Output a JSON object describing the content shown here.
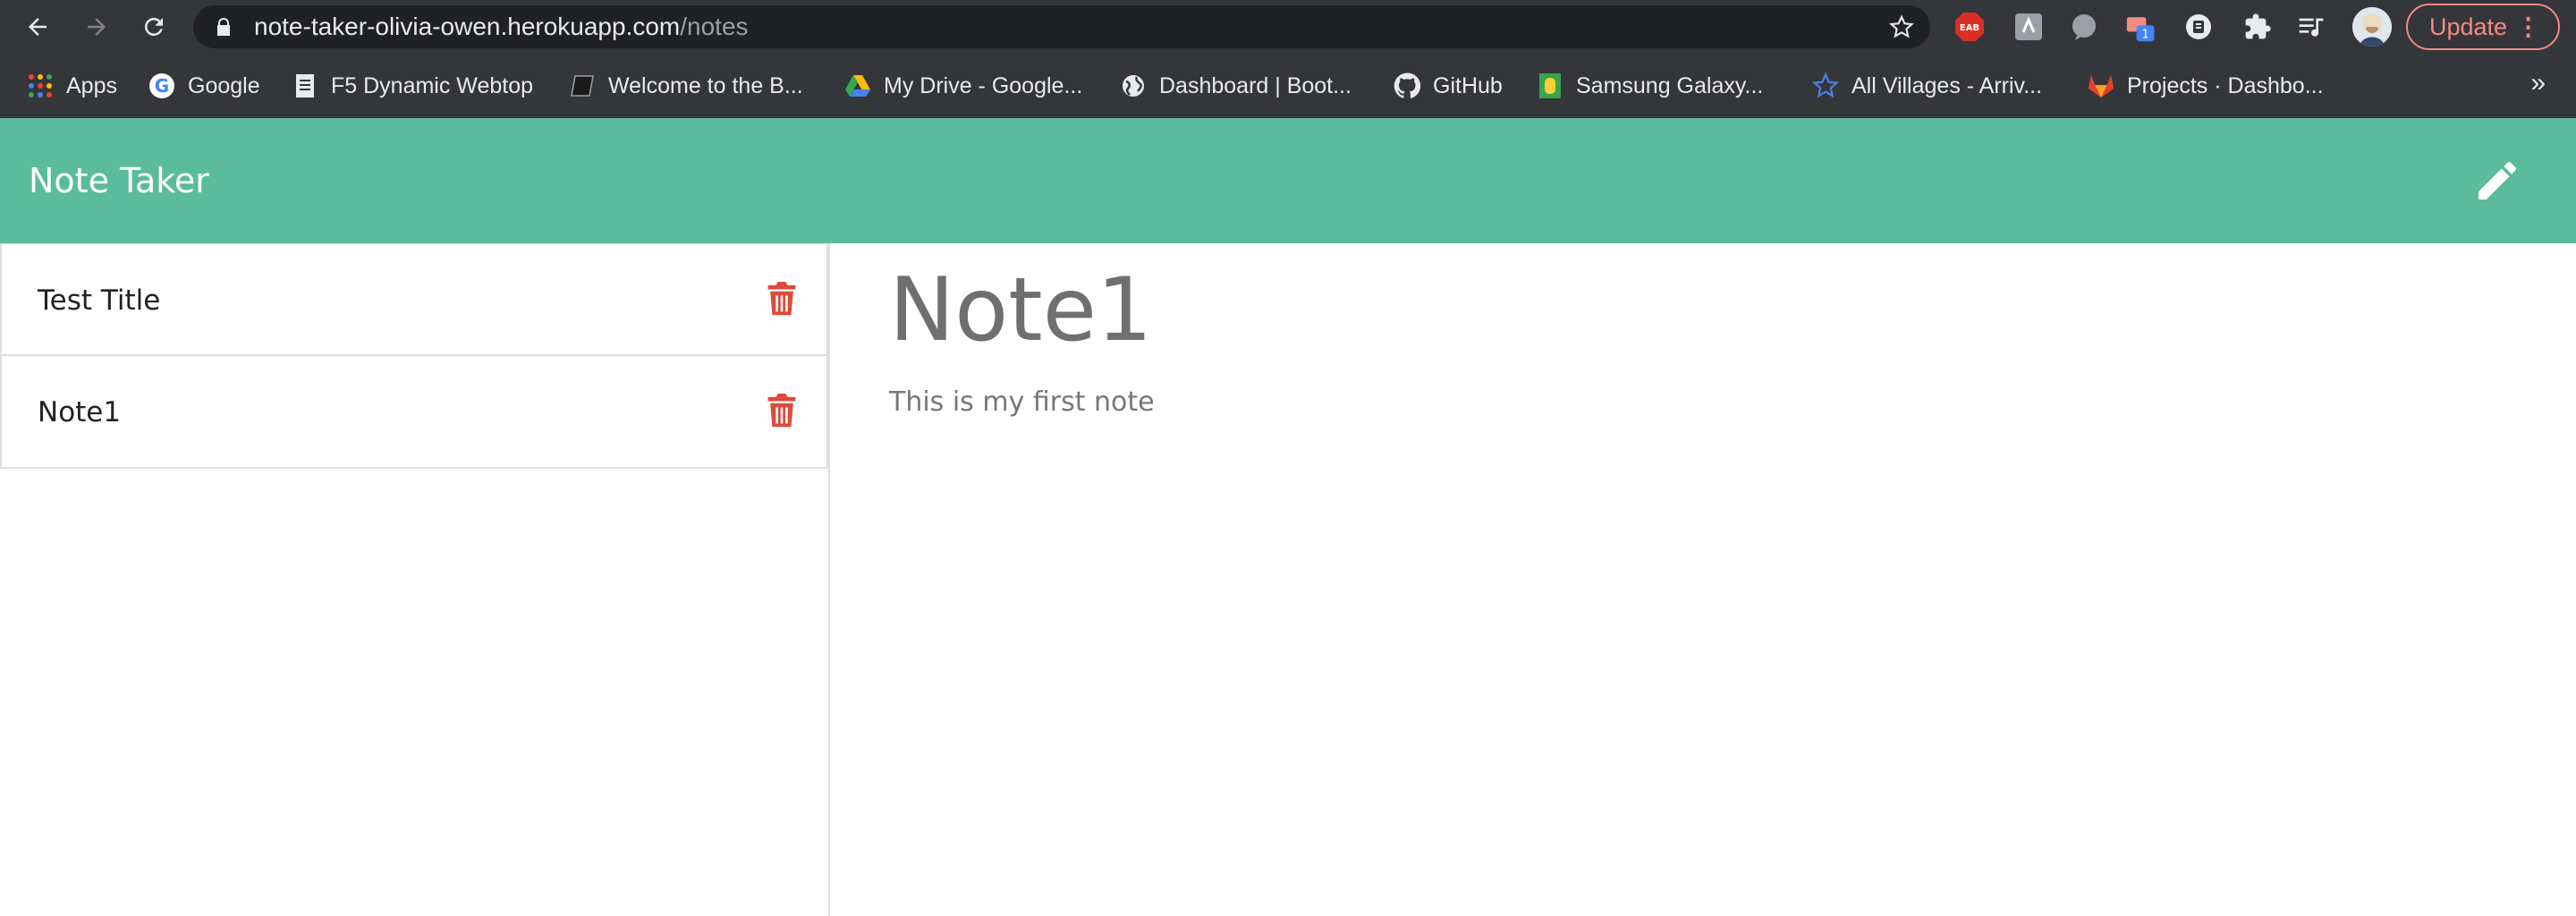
{
  "browser": {
    "url_host": "note-taker-olivia-owen.herokuapp.com",
    "url_path": "/notes",
    "update_label": "Update",
    "update_menu": "⋮",
    "extension_badge": "1",
    "eab_label": "EAB",
    "bookmarks_more": "»",
    "bookmarks": [
      {
        "label": "Apps",
        "icon": "apps-grid-icon"
      },
      {
        "label": "Google",
        "icon": "google-icon"
      },
      {
        "label": "F5 Dynamic Webtop",
        "icon": "document-icon"
      },
      {
        "label": "Welcome to the B...",
        "icon": "book-icon"
      },
      {
        "label": "My Drive - Google...",
        "icon": "drive-icon"
      },
      {
        "label": "Dashboard | Boot...",
        "icon": "globe-icon"
      },
      {
        "label": "GitHub",
        "icon": "github-icon"
      },
      {
        "label": "Samsung Galaxy...",
        "icon": "samsung-icon"
      },
      {
        "label": "All Villages - Arriv...",
        "icon": "star-icon"
      },
      {
        "label": "Projects · Dashbo...",
        "icon": "gitlab-icon"
      }
    ]
  },
  "app": {
    "brand": "Note Taker",
    "accent_color": "#5abc9c",
    "delete_color": "#dc4b3c",
    "notes": [
      {
        "title": "Test Title"
      },
      {
        "title": "Note1"
      }
    ],
    "active_note": {
      "title": "Note1",
      "text": "This is my first note"
    }
  }
}
